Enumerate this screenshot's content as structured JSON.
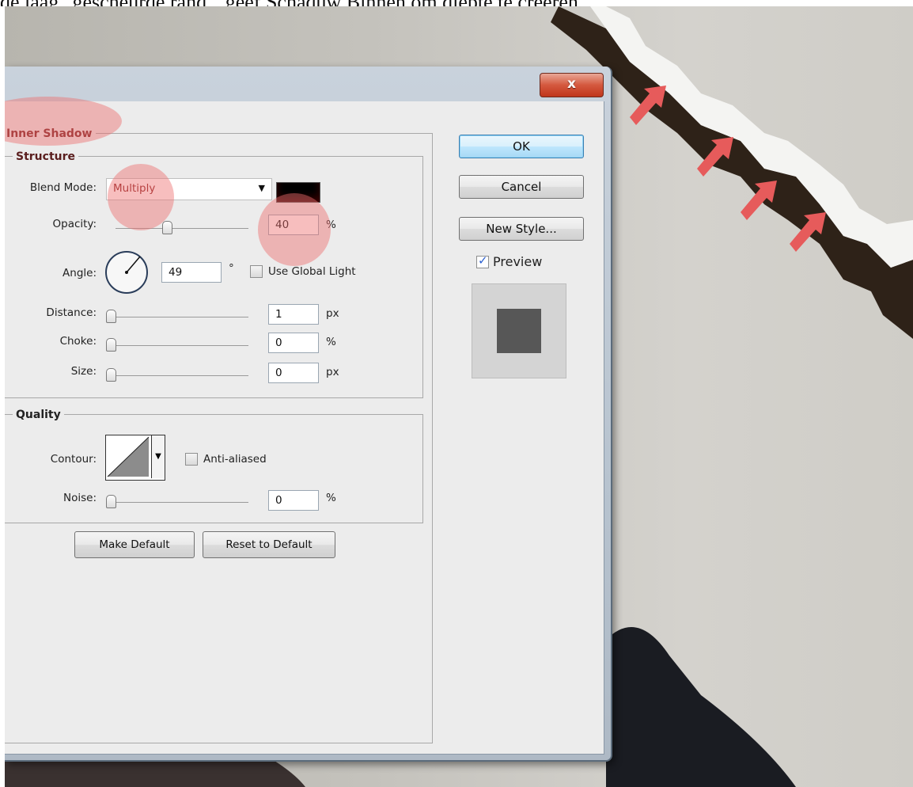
{
  "caption": "de laag \"gescheurde rand\", geef Schaduw Binnen om diepte te creëren.",
  "window": {
    "close_label": "x"
  },
  "inner_shadow": {
    "title": "Inner Shadow",
    "structure": {
      "title": "Structure",
      "blend_mode_label": "Blend Mode:",
      "blend_mode_value": "Multiply",
      "opacity_label": "Opacity:",
      "opacity_value": "40",
      "opacity_unit": "%",
      "opacity_fraction": 0.4,
      "angle_label": "Angle:",
      "angle_value": "49",
      "angle_unit": "°",
      "use_global_light_label": "Use Global Light",
      "use_global_light_checked": false,
      "distance_label": "Distance:",
      "distance_value": "1",
      "distance_unit": "px",
      "choke_label": "Choke:",
      "choke_value": "0",
      "choke_unit": "%",
      "size_label": "Size:",
      "size_value": "0",
      "size_unit": "px",
      "shadow_color": "#000000"
    },
    "quality": {
      "title": "Quality",
      "contour_label": "Contour:",
      "anti_aliased_label": "Anti-aliased",
      "anti_aliased_checked": false,
      "noise_label": "Noise:",
      "noise_value": "0",
      "noise_unit": "%"
    },
    "make_default_label": "Make Default",
    "reset_default_label": "Reset to Default"
  },
  "side_buttons": {
    "ok_label": "OK",
    "cancel_label": "Cancel",
    "new_style_label": "New Style...",
    "preview_label": "Preview",
    "preview_checked": true
  },
  "colors": {
    "highlight": "#ee6e6e",
    "arrow": "#e65b5b",
    "preview_swatch": "#575757"
  }
}
